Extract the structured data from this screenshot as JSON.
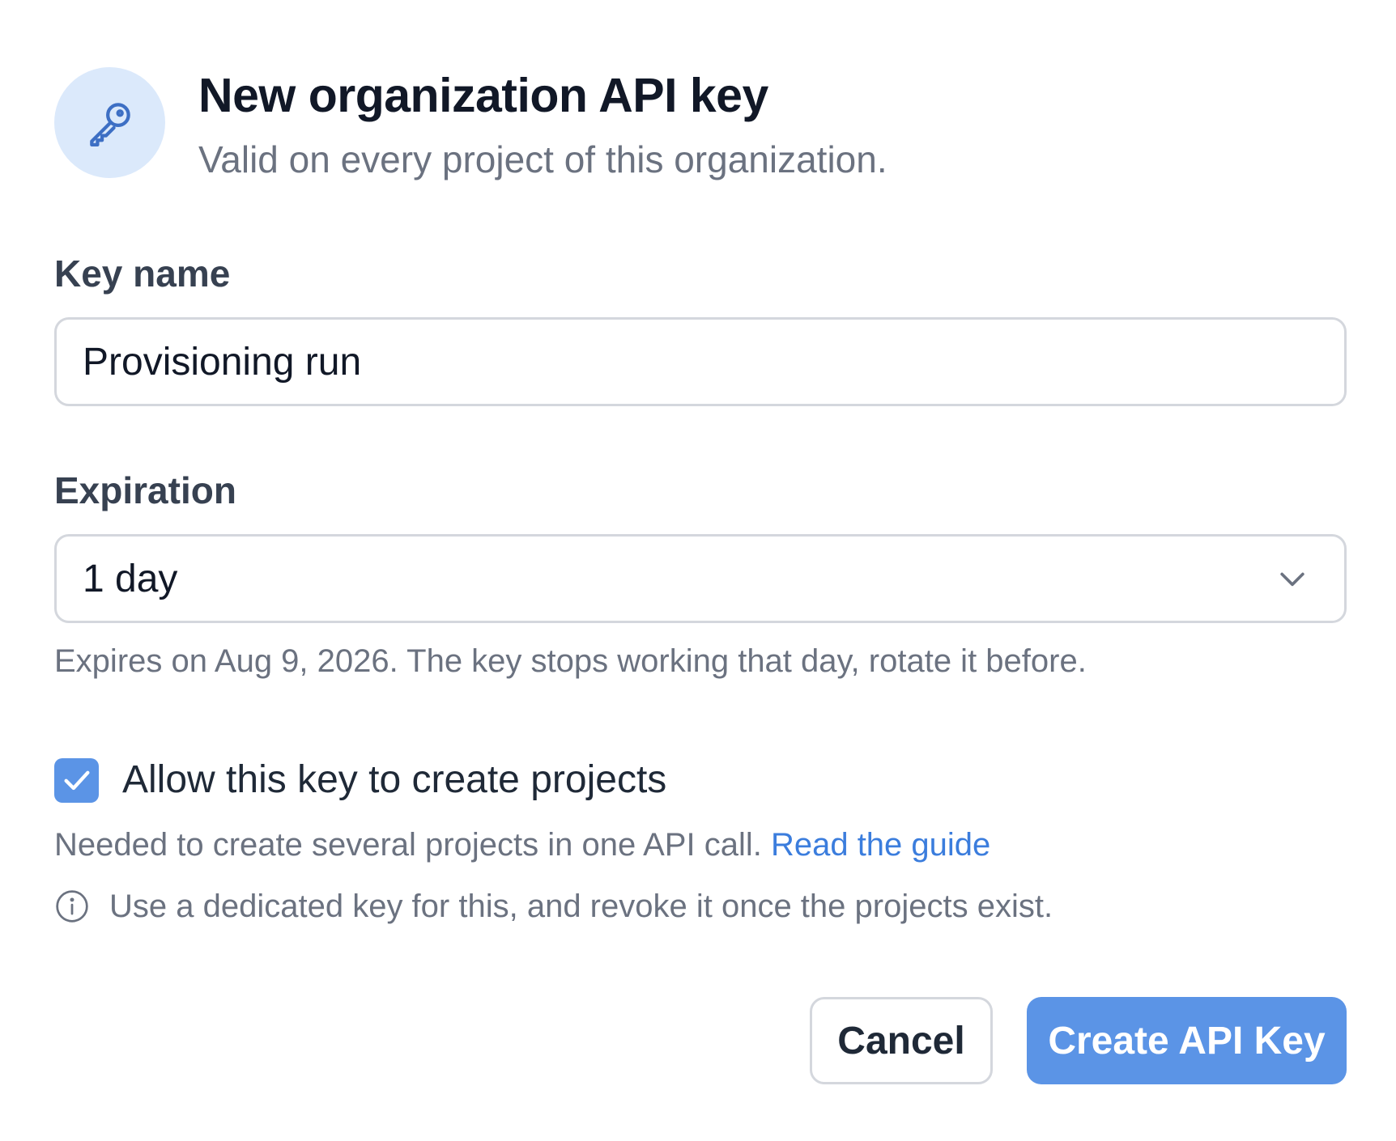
{
  "dialog": {
    "title": "New organization API key",
    "subtitle": "Valid on every project of this organization."
  },
  "key_name": {
    "label": "Key name",
    "value": "Provisioning run"
  },
  "expiration": {
    "label": "Expiration",
    "selected": "1 day",
    "help": "Expires on Aug 9, 2026. The key stops working that day, rotate it before."
  },
  "create_projects": {
    "checked": true,
    "label": "Allow this key to create projects",
    "help": "Needed to create several projects in one API call.",
    "link_text": "Read the guide",
    "note": "Use a dedicated key for this, and revoke it once the projects exist."
  },
  "actions": {
    "cancel_label": "Cancel",
    "create_label": "Create API Key"
  },
  "icons": {
    "badge": "key-icon",
    "select": "chevron-down-icon",
    "checkbox": "check-icon",
    "note": "info-icon"
  },
  "colors": {
    "accent": "#5b94e6",
    "link": "#3b7ddd",
    "badge_bg": "#dbe9fb",
    "border": "#d4d7dd",
    "muted_text": "#6b7280"
  }
}
